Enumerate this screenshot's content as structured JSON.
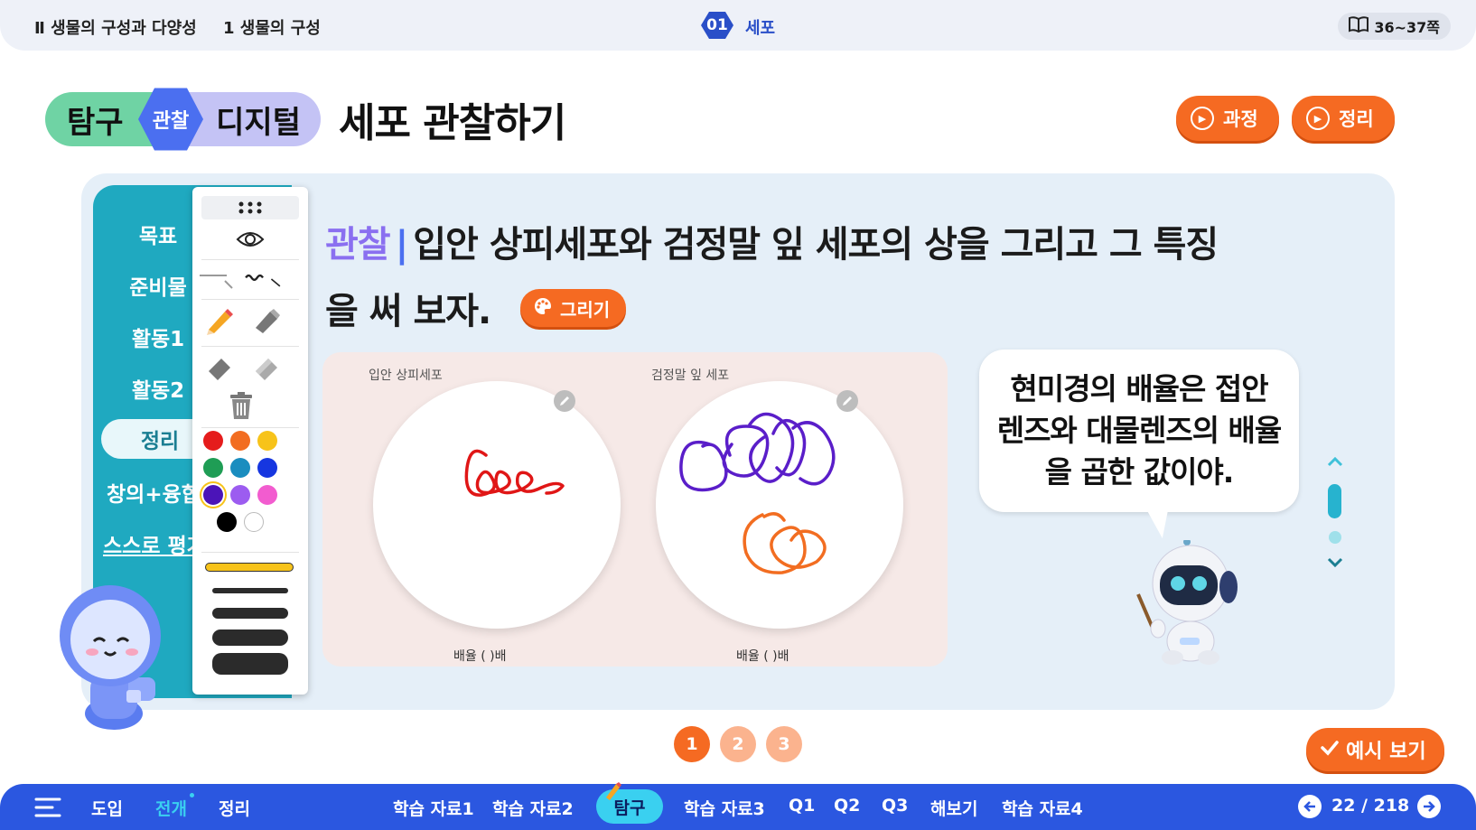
{
  "topbar": {
    "crumb1": "Ⅱ 생물의 구성과 다양성",
    "crumb2": "1 생물의 구성",
    "unit_num": "01",
    "unit_title": "세포",
    "page_ref": "36~37쪽"
  },
  "title": {
    "pill1": "탐구",
    "badge": "관찰",
    "pill2": "디지털",
    "text": "세포 관찰하기",
    "btn_process": "과정",
    "btn_summary": "정리"
  },
  "leftnav": {
    "items": [
      "목표",
      "준비물",
      "활동1",
      "활동2",
      "정리",
      "창의+융합",
      "스스로 평가"
    ],
    "active": "정리"
  },
  "question": {
    "label": "관찰",
    "bar": "|",
    "line1": "입안 상피세포와 검정말 잎 세포의 상을 그리고 그 특징",
    "line2": "을 써 보자.",
    "draw_button": "그리기"
  },
  "drawing": {
    "left_label": "입안 상피세포",
    "right_label": "검정말 잎 세포",
    "left_mag": "배율 (          )배",
    "right_mag": "배율 (          )배"
  },
  "toolbox": {
    "colors": [
      "#e51c1c",
      "#f26d21",
      "#f7c31a",
      "#1f9d55",
      "#1a8dbf",
      "#1636e0",
      "#4b14b8",
      "#9c5cf0",
      "#f25ccf",
      "#000000",
      "#ffffff"
    ],
    "selected_color": "#4b14b8"
  },
  "bubble": {
    "text": "현미경의 배율은 접안 렌즈와 대물렌즈의 배율을 곱한 값이야."
  },
  "pagination": {
    "pages": [
      "1",
      "2",
      "3"
    ],
    "current": "1",
    "example_button": "예시 보기"
  },
  "bottombar": {
    "menu_items": [
      "도입",
      "전개",
      "정리"
    ],
    "active_menu": "전개",
    "tabs": [
      "학습 자료1",
      "학습 자료2",
      "탐구",
      "학습 자료3",
      "Q1",
      "Q2",
      "Q3",
      "해보기",
      "학습 자료4"
    ],
    "active_tab": "탐구",
    "page_count": "22 / 218"
  }
}
